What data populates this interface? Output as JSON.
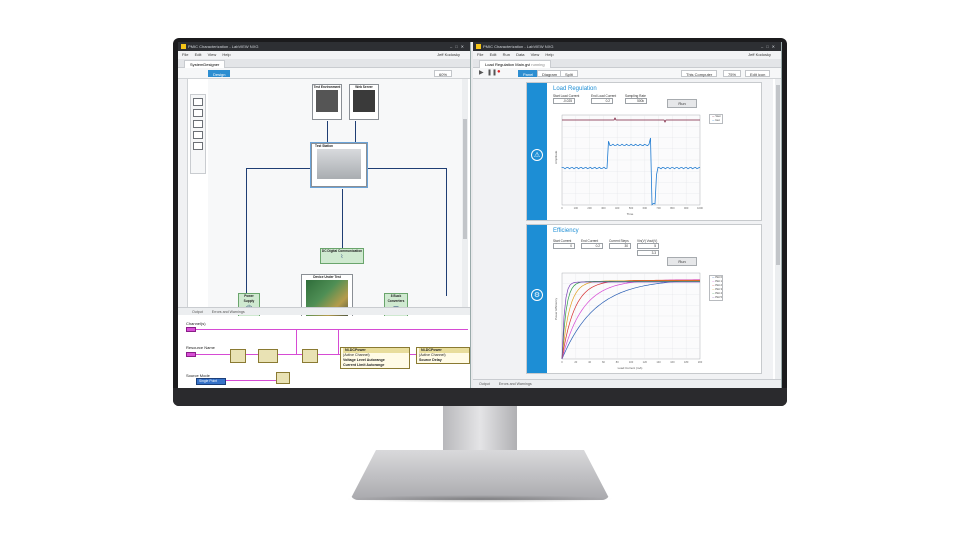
{
  "left_window": {
    "title": "PMIC Characterization - LabVIEW NXG",
    "menu": [
      "File",
      "Edit",
      "View",
      "Help"
    ],
    "user": "Jeff Kodosky",
    "doc_tab": "SystemDesigner",
    "mode_button": "Design",
    "zoom": "60%",
    "nodes": {
      "test_environment": "Test Environment",
      "web_server": "Web Server",
      "test_station": "Test Station",
      "dc_digital": "DC Digital Communication",
      "dut": "Device Under Test",
      "power_supply": "Power Supply",
      "buck": "8 Buck Converters"
    },
    "bottom_tabs": [
      "Output",
      "Errors and Warnings"
    ]
  },
  "block_diagram": {
    "channels_label": "Channel(s)",
    "resource_label": "Resource Name",
    "source_mode_label": "Source Mode",
    "source_mode_value": "Single Point",
    "node1": {
      "header": "NI-DCPower",
      "rows": [
        "(Active Channel)",
        "Voltage Level Autorange",
        "Current Limit Autorange"
      ]
    },
    "node2": {
      "header": "NI-DCPower",
      "rows": [
        "(Active Channel)",
        "Source Delay"
      ]
    }
  },
  "right_window": {
    "title": "PMIC Characterization - LabVIEW NXG",
    "menu": [
      "File",
      "Edit",
      "Run",
      "Data",
      "View",
      "Help"
    ],
    "user": "Jeff Kodosky",
    "doc_tab": "Load Regulation Main.gvi",
    "doc_tab_state": "running",
    "tabs": [
      "Panel",
      "Diagram",
      "Split"
    ],
    "target": "This Computer",
    "zoom": "75%",
    "edit_icon_label": "Edit icon",
    "bottom_tabs": [
      "Output",
      "Errors and Warnings"
    ]
  },
  "load_regulation": {
    "title": "Load Regulation",
    "fields": [
      {
        "label": "Start Load Current",
        "value": "-0.025"
      },
      {
        "label": "End Load Current",
        "value": "0.2"
      },
      {
        "label": "Sampling Rate",
        "value": "500k"
      }
    ],
    "run_label": "Run",
    "legend": [
      "Vout",
      "Iout"
    ],
    "y_axis_label": "Amplitude",
    "x_axis_label": "Time",
    "x_ticks": [
      "0",
      "100",
      "200",
      "300",
      "400",
      "500",
      "600",
      "700",
      "800",
      "900",
      "1000"
    ],
    "colors": {
      "vout": "#7a1f3c",
      "iout": "#1f7bd1"
    }
  },
  "efficiency": {
    "title": "Efficiency",
    "fields": [
      {
        "label": "Start Current",
        "value": "0"
      },
      {
        "label": "End Current",
        "value": "0.2"
      },
      {
        "label": "Current Steps",
        "value": "30"
      },
      {
        "label": "Vin/Vout",
        "value": "5"
      },
      {
        "label": "",
        "value": "3.3"
      }
    ],
    "header_extra": "Vin(V) Vout(V)",
    "run_label": "Run",
    "legend": [
      "Plot 0",
      "Plot 1",
      "Plot 2",
      "Plot 3",
      "Plot 4",
      "Plot 5"
    ],
    "y_axis_label": "Power Efficiency",
    "x_axis_label": "Load Current (mA)",
    "x_ticks": [
      "0",
      "20",
      "40",
      "60",
      "80",
      "100",
      "120",
      "140",
      "160",
      "180",
      "200"
    ],
    "colors": [
      "#2b5fb4",
      "#d64bd4",
      "#d62f2f",
      "#e0a020",
      "#2e9e49",
      "#7a3fb8"
    ]
  }
}
